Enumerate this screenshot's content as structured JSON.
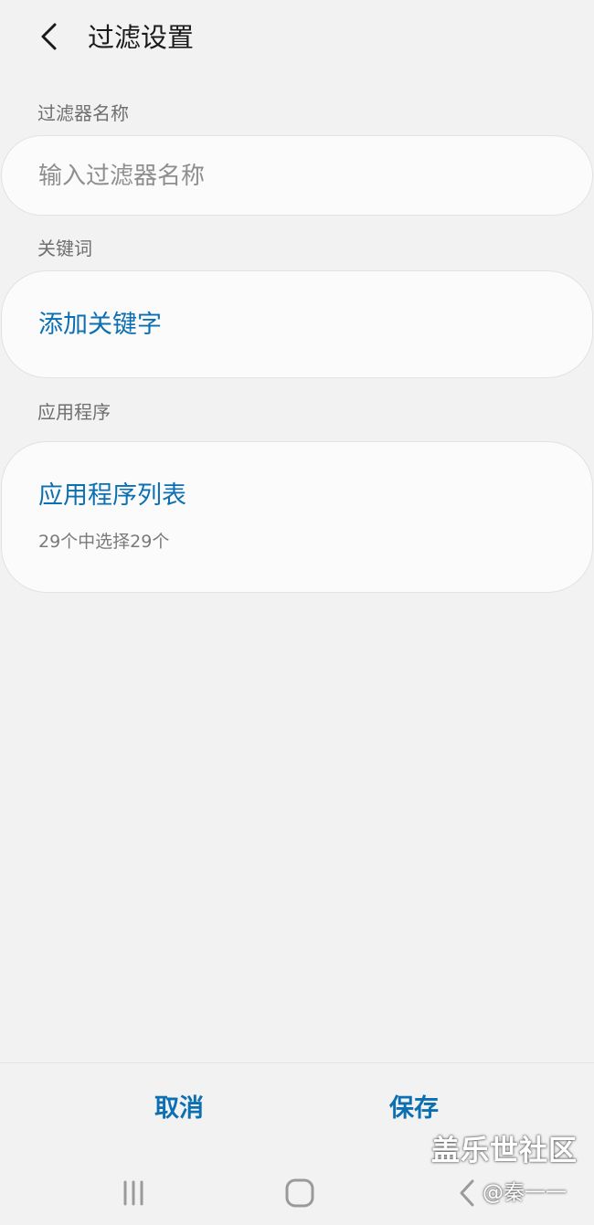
{
  "header": {
    "title": "过滤设置",
    "back_icon": "chevron-left-icon"
  },
  "filter_name": {
    "label": "过滤器名称",
    "value": "",
    "placeholder": "输入过滤器名称"
  },
  "keywords": {
    "label": "关键词",
    "add_label": "添加关键字"
  },
  "apps": {
    "label": "应用程序",
    "list_title": "应用程序列表",
    "summary": "29个中选择29个"
  },
  "actions": {
    "cancel_label": "取消",
    "save_label": "保存"
  },
  "nav_bar": {
    "recents_icon": "recents-icon",
    "home_icon": "home-icon",
    "back_icon": "back-icon"
  },
  "watermark": {
    "brand": "盖乐世社区",
    "user": "@秦一一"
  },
  "colors": {
    "accent": "#0b6fb2",
    "background": "#f2f2f2",
    "card": "#fbfbfb"
  }
}
